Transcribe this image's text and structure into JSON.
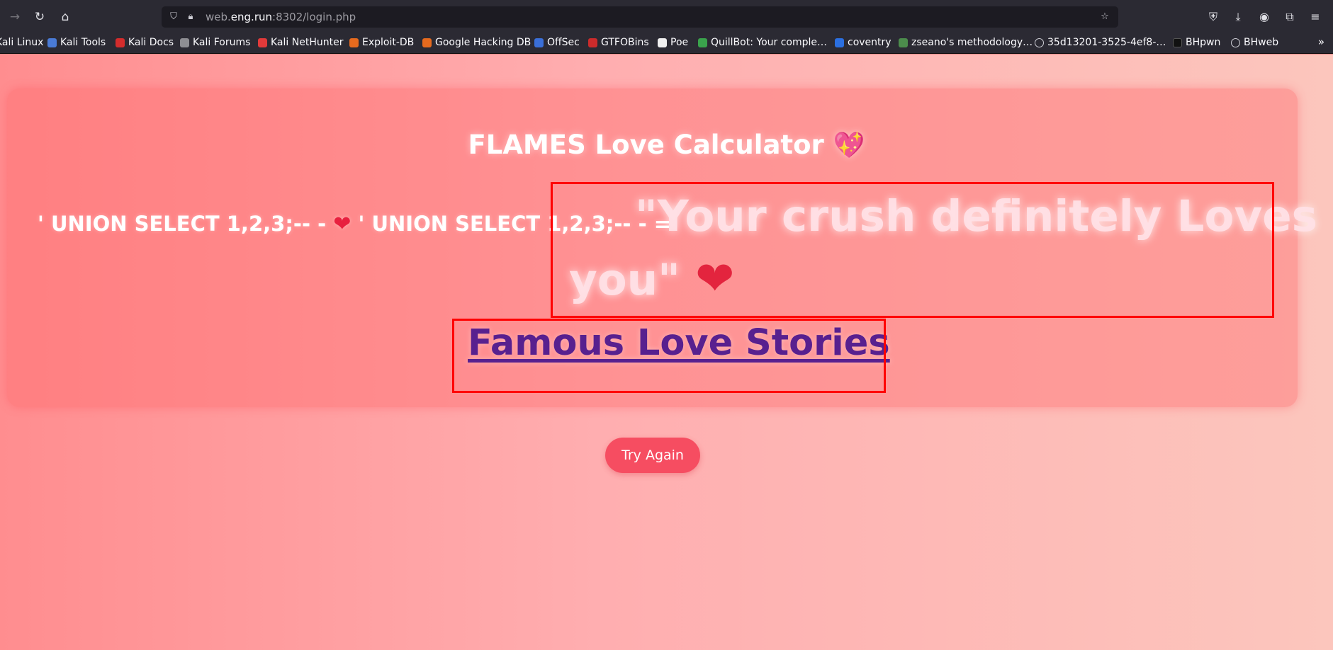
{
  "browser": {
    "url_prefix": "web.",
    "url_host": "eng.run",
    "url_rest": ":8302/login.php",
    "nav_icons": [
      "back-arrow-icon",
      "reload-icon",
      "home-icon"
    ],
    "right_icons": [
      "pocket-icon",
      "download-icon",
      "account-icon",
      "extensions-icon",
      "menu-icon"
    ]
  },
  "bookmarks": [
    {
      "label": "Kali Linux",
      "icon": "kali-icon",
      "color": "#3a84d8"
    },
    {
      "label": "Kali Tools",
      "icon": "kali-tools-icon",
      "color": "#4a7bd6"
    },
    {
      "label": "Kali Docs",
      "icon": "kali-docs-icon",
      "color": "#d42c2c"
    },
    {
      "label": "Kali Forums",
      "icon": "kali-forums-icon",
      "color": "#8e8e93"
    },
    {
      "label": "Kali NetHunter",
      "icon": "nethunter-icon",
      "color": "#e23a3a"
    },
    {
      "label": "Exploit-DB",
      "icon": "exploit-db-icon",
      "color": "#e66a1e"
    },
    {
      "label": "Google Hacking DB",
      "icon": "ghdb-icon",
      "color": "#e66a1e"
    },
    {
      "label": "OffSec",
      "icon": "offsec-icon",
      "color": "#3a6fd8"
    },
    {
      "label": "GTFOBins",
      "icon": "gtfobins-icon",
      "color": "#cc2b2b"
    },
    {
      "label": "Poe",
      "icon": "poe-icon",
      "color": "#f0f0f0"
    },
    {
      "label": "QuillBot: Your comple…",
      "icon": "quillbot-icon",
      "color": "#3aa34c"
    },
    {
      "label": "coventry",
      "icon": "coventry-icon",
      "color": "#2b6fe0"
    },
    {
      "label": "zseano's methodology…",
      "icon": "zseano-icon",
      "color": "#4c8c4c"
    },
    {
      "label": "35d13201-3525-4ef8-…",
      "icon": "globe-icon",
      "color": "#cfcfd6"
    },
    {
      "label": "BHpwn",
      "icon": "medium-icon",
      "color": "#111111"
    },
    {
      "label": "BHweb",
      "icon": "globe-icon",
      "color": "#cfcfd6"
    }
  ],
  "page": {
    "title": "FLAMES Love Calculator",
    "title_emoji": "💖",
    "name1": "' UNION SELECT 1,2,3;-- -",
    "heart": "❤",
    "name2": "' UNION SELECT 1,2,3;-- -",
    "equals": "=",
    "verdict_line1": "\"Your crush definitely Loves",
    "verdict_line2": "you\"",
    "verdict_heart": "❤",
    "stories_link": "Famous Love Stories",
    "try_again": "Try Again"
  }
}
